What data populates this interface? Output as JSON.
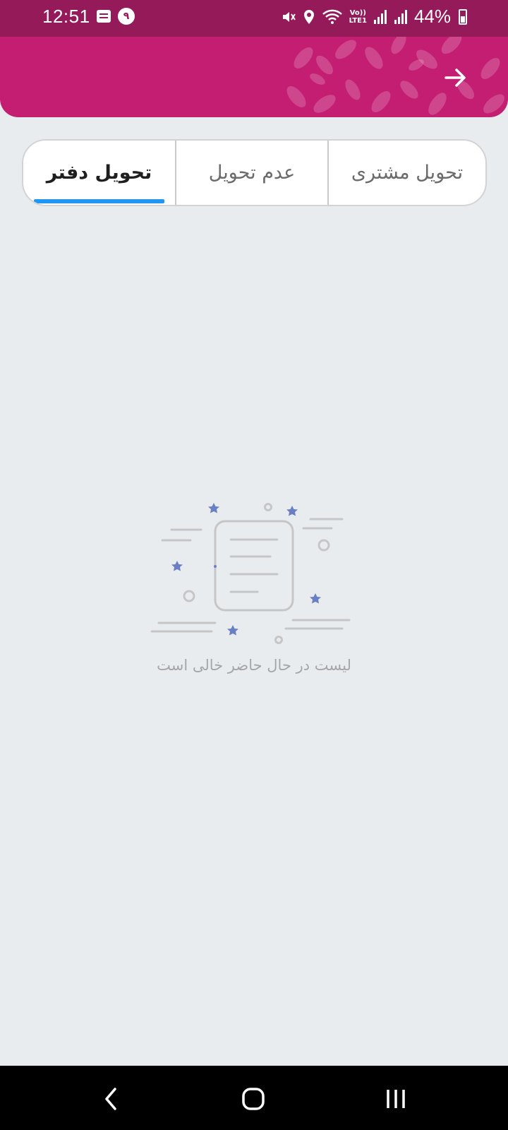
{
  "status_bar": {
    "time": "12:51",
    "notification_badge": "۹",
    "battery": "44%",
    "network_label_top": "Vo))",
    "network_label_bottom": "LTE1",
    "icons": [
      "message-icon",
      "mute-icon",
      "location-icon",
      "wifi-icon",
      "signal-icon",
      "signal-icon",
      "battery-icon"
    ]
  },
  "header": {
    "back_icon": "arrow-right-icon",
    "colors": {
      "status_bar": "#941a59",
      "header": "#c41e73"
    }
  },
  "tabs": [
    {
      "label": "تحویل مشتری",
      "selected": false
    },
    {
      "label": "عدم تحویل",
      "selected": false
    },
    {
      "label": "تحویل دفتر",
      "selected": true
    }
  ],
  "accent_color": "#2196f3",
  "empty_state": {
    "message": "لیست در حال حاضر خالی است",
    "icon": "empty-document-icon"
  },
  "nav_bar": {
    "buttons": [
      "back-icon",
      "home-icon",
      "recents-icon"
    ]
  }
}
